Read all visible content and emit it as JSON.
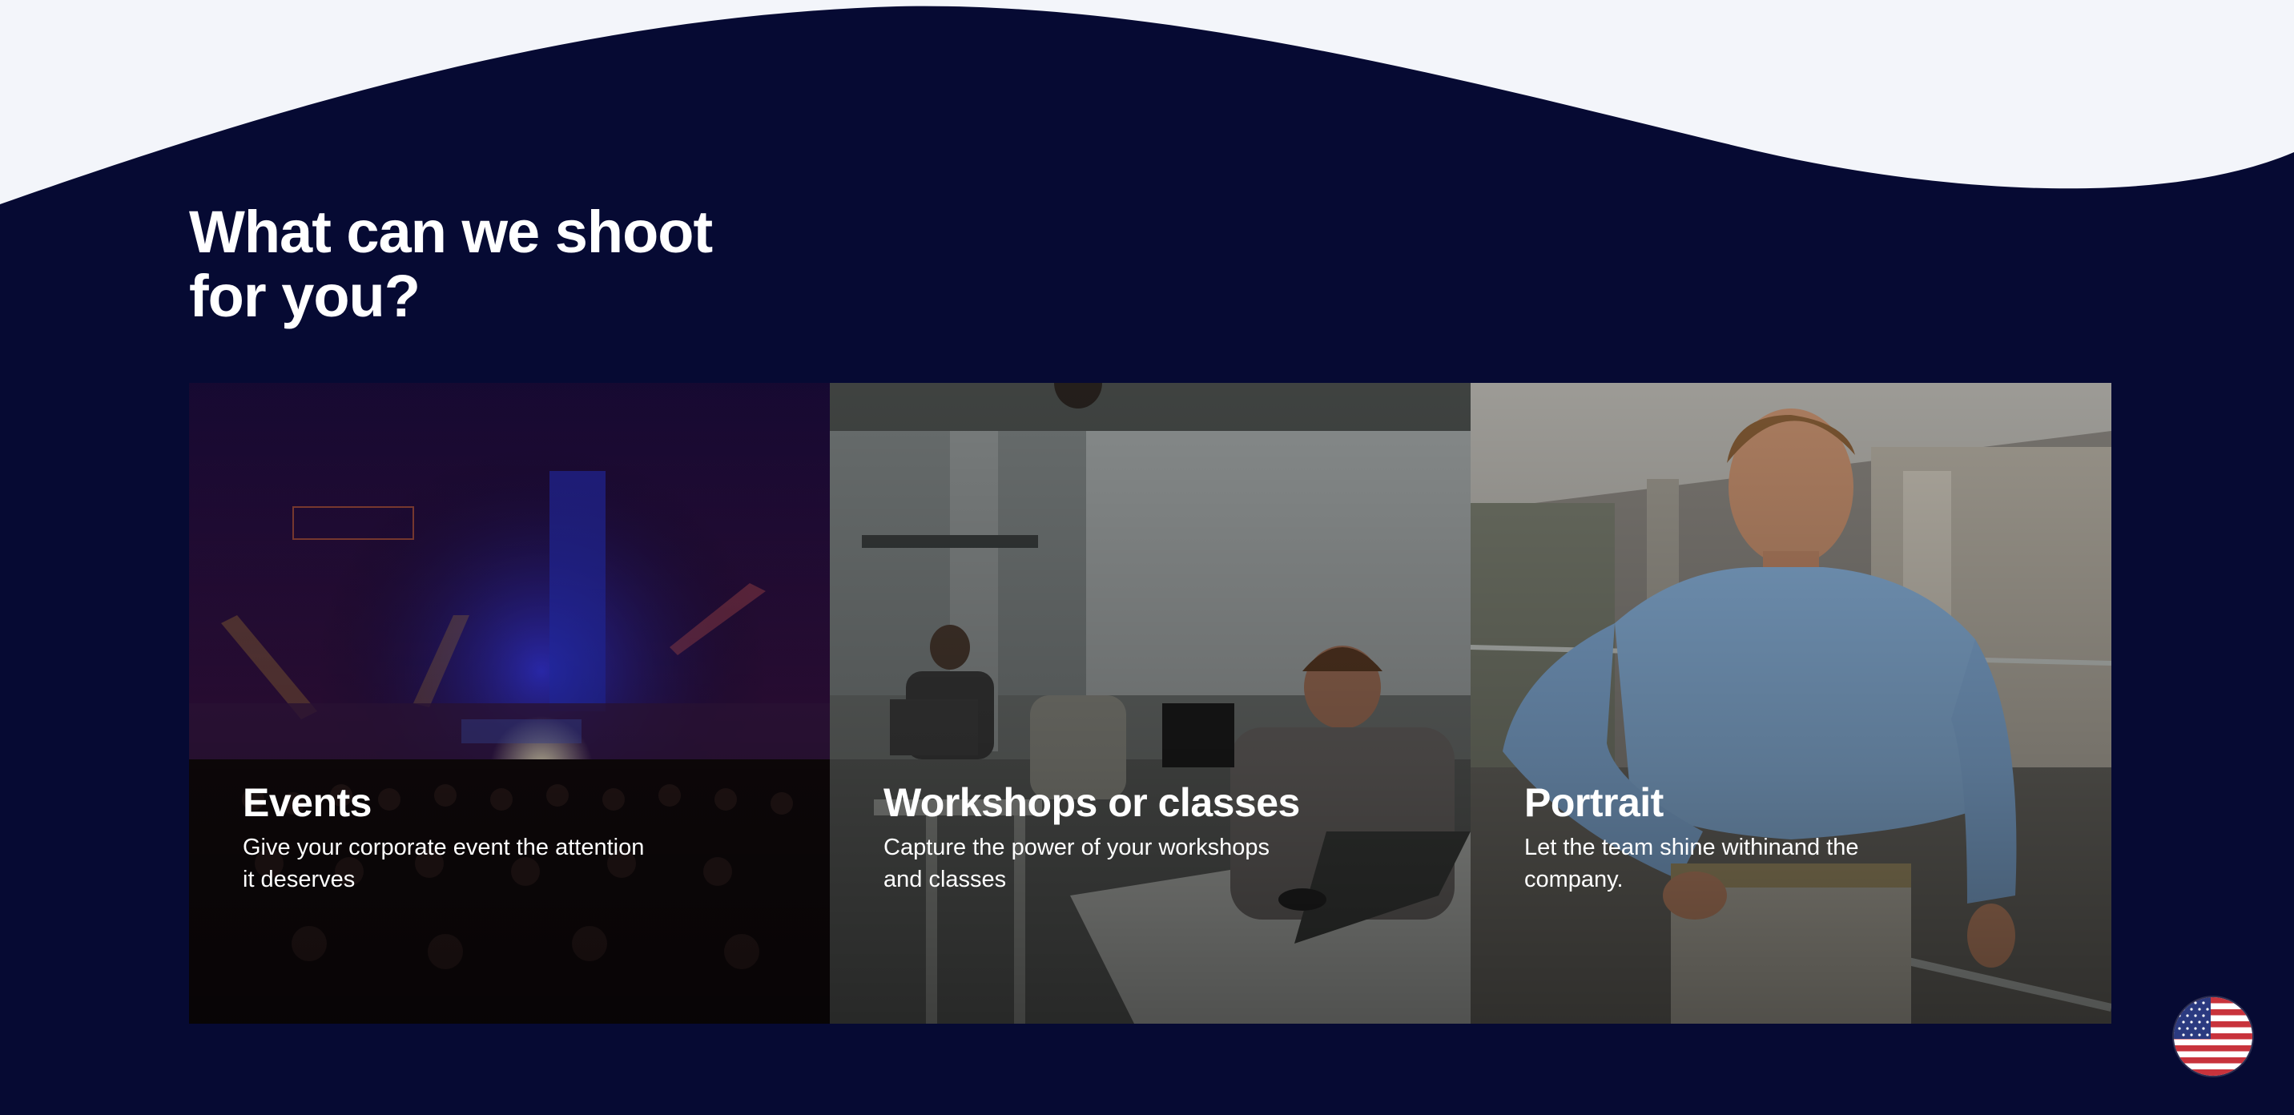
{
  "section": {
    "heading": "What can we shoot for you?"
  },
  "cards": [
    {
      "title": "Events",
      "description": "Give your corporate event the attention it deserves",
      "image": "conference-stage-photo"
    },
    {
      "title": "Workshops or classes",
      "description": "Capture the power of your workshops and classes",
      "image": "workshop-laptops-photo"
    },
    {
      "title": "Portrait",
      "description": "Let the team shine withinand the company.",
      "image": "man-blue-shirt-portrait-photo"
    }
  ],
  "language_switcher": {
    "icon": "us-flag-icon"
  },
  "colors": {
    "background": "#060a33",
    "wave": "#f3f5fa",
    "text": "#ffffff"
  }
}
